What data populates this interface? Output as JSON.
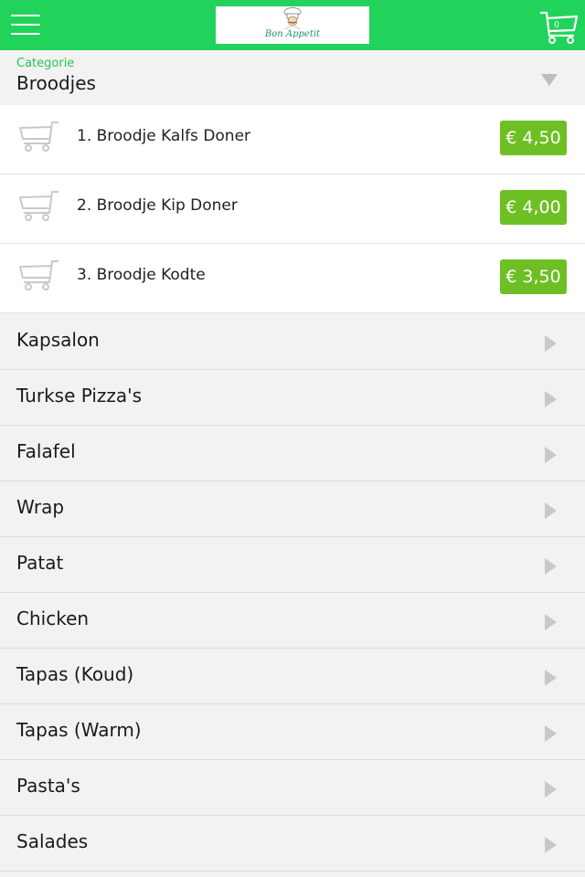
{
  "header": {
    "menu_icon": "hamburger-icon",
    "logo_text": "Bon Appetit",
    "cart_icon": "shopping-cart-icon",
    "cart_count": "0",
    "bg_color": "#21d35b"
  },
  "category_selector": {
    "label": "Categorie",
    "value": "Broodjes",
    "icon": "chevron-down-icon"
  },
  "products": [
    {
      "name": "1. Broodje Kalfs Doner",
      "price": "€ 4,50"
    },
    {
      "name": "2. Broodje Kip Doner",
      "price": "€ 4,00"
    },
    {
      "name": "3. Broodje Kodte",
      "price": "€ 3,50"
    }
  ],
  "categories": [
    {
      "name": "Kapsalon"
    },
    {
      "name": "Turkse Pizza's"
    },
    {
      "name": "Falafel"
    },
    {
      "name": "Wrap"
    },
    {
      "name": "Patat"
    },
    {
      "name": "Chicken"
    },
    {
      "name": "Tapas (Koud)"
    },
    {
      "name": "Tapas (Warm)"
    },
    {
      "name": "Pasta's"
    },
    {
      "name": "Salades"
    }
  ],
  "colors": {
    "accent_green": "#21d35b",
    "price_green": "#6dbf23",
    "label_green": "#21c55a"
  }
}
